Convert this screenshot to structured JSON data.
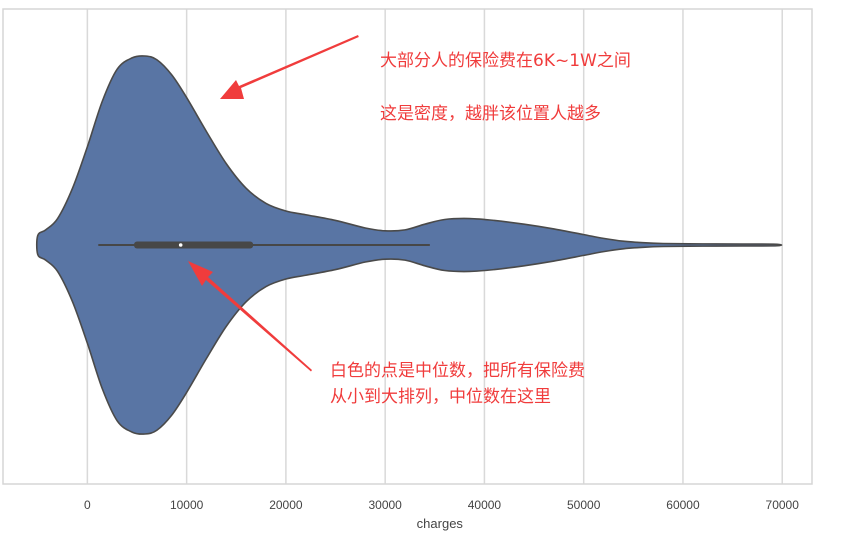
{
  "chart_data": {
    "type": "violin",
    "orientation": "horizontal",
    "title": "",
    "xlabel": "charges",
    "ylabel": "",
    "xlim": [
      -8500,
      73000
    ],
    "xticks": [
      0,
      10000,
      20000,
      30000,
      40000,
      50000,
      60000,
      70000
    ],
    "xtick_labels": [
      "0",
      "10000",
      "20000",
      "30000",
      "40000",
      "50000",
      "60000",
      "70000"
    ],
    "grid": "vertical",
    "fill_color": "#5975a4",
    "edge_color": "#4a4a4a",
    "box_color": "#474747",
    "median_color": "#ffffff",
    "density_profile": {
      "x": [
        -5000,
        -4200,
        -3000,
        -1500,
        0,
        1500,
        3000,
        4500,
        5800,
        7000,
        8500,
        10000,
        12000,
        14000,
        16000,
        18000,
        20000,
        22000,
        25000,
        28000,
        30000,
        32000,
        34000,
        36000,
        38500,
        41000,
        44000,
        47000,
        50000,
        52000,
        54000,
        56000,
        58000,
        62000,
        66000,
        69500
      ],
      "relative_width": [
        0.05,
        0.08,
        0.14,
        0.3,
        0.52,
        0.76,
        0.93,
        0.99,
        1.0,
        0.98,
        0.9,
        0.78,
        0.6,
        0.43,
        0.3,
        0.22,
        0.18,
        0.16,
        0.13,
        0.09,
        0.075,
        0.08,
        0.11,
        0.135,
        0.14,
        0.13,
        0.11,
        0.085,
        0.055,
        0.035,
        0.02,
        0.012,
        0.008,
        0.006,
        0.005,
        0.004
      ]
    },
    "box": {
      "whisker_low": 1100,
      "q1": 4700,
      "median": 9400,
      "q3": 16700,
      "whisker_high": 34500,
      "max": 69500
    }
  },
  "annotations": [
    {
      "id": "peak-note-line1",
      "text": "大部分人的保险费在6K~1W之间"
    },
    {
      "id": "peak-note-line2",
      "text": "这是密度，越胖该位置人越多"
    },
    {
      "id": "median-note-line1",
      "text": "白色的点是中位数，把所有保险费"
    },
    {
      "id": "median-note-line2",
      "text": "从小到大排列，中位数在这里"
    }
  ],
  "annotation_color": "#f03c3c"
}
